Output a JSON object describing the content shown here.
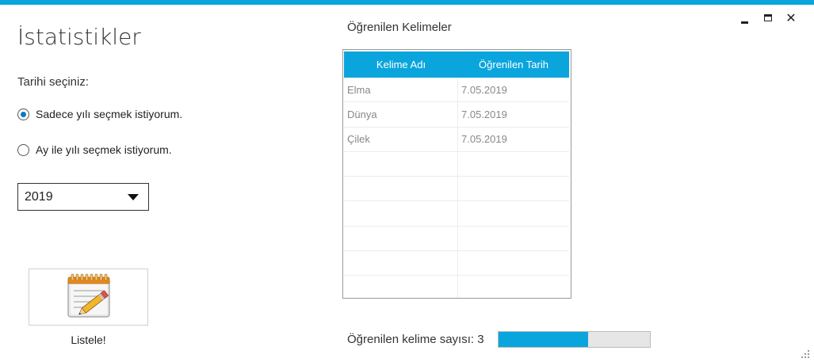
{
  "window": {
    "minimize_label": "",
    "maximize_label": "",
    "close_label": "✕"
  },
  "page": {
    "title": "İstatistikler"
  },
  "date_selection": {
    "label": "Tarihi seçiniz:",
    "options": [
      {
        "label": "Sadece yılı seçmek istiyorum.",
        "checked": true
      },
      {
        "label": "Ay ile yılı seçmek istiyorum.",
        "checked": false
      }
    ],
    "year_select": {
      "value": "2019"
    }
  },
  "list_button": {
    "label": "Listele!",
    "icon": "notepad-pencil-icon"
  },
  "words_table": {
    "title": "Öğrenilen Kelimeler",
    "columns": [
      "Kelime Adı",
      "Öğrenilen Tarih"
    ],
    "rows": [
      [
        "Elma",
        "7.05.2019"
      ],
      [
        "Dünya",
        "7.05.2019"
      ],
      [
        "Çilek",
        "7.05.2019"
      ],
      [
        "",
        ""
      ],
      [
        "",
        ""
      ],
      [
        "",
        ""
      ],
      [
        "",
        ""
      ],
      [
        "",
        ""
      ],
      [
        "",
        ""
      ]
    ]
  },
  "word_count": {
    "label": "Öğrenilen kelime sayısı: 3",
    "progress": 0.59
  },
  "colors": {
    "accent": "#0aa5dc",
    "radio_selected": "#0a79c4"
  }
}
